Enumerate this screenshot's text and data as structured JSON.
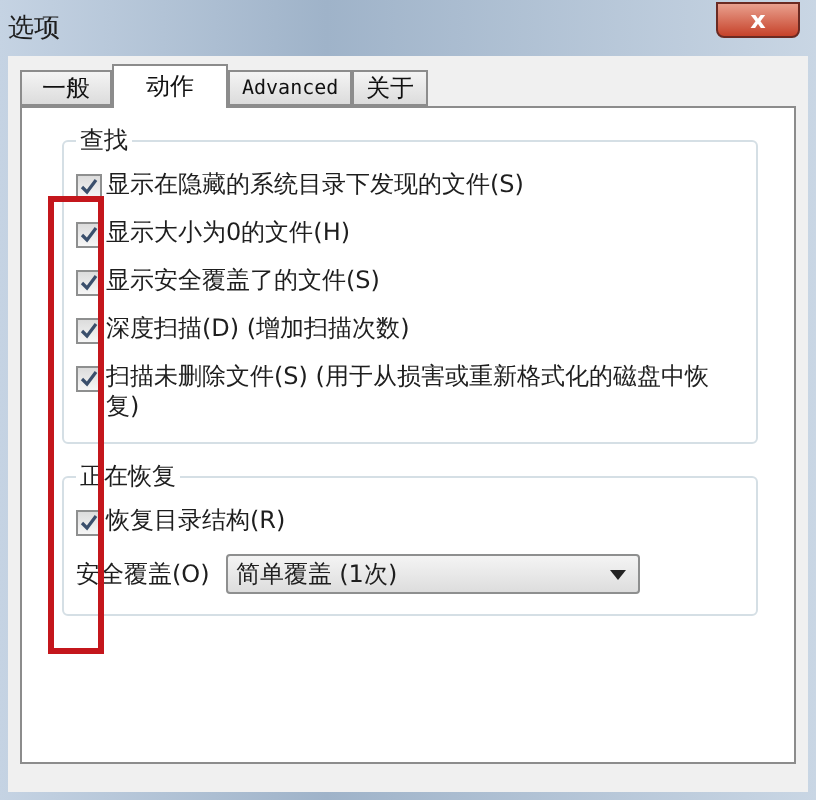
{
  "window": {
    "title": "选项",
    "close": "x"
  },
  "tabs": [
    {
      "label": "一般",
      "selected": false
    },
    {
      "label": "动作",
      "selected": true
    },
    {
      "label": "Advanced",
      "selected": false
    },
    {
      "label": "关于",
      "selected": false
    }
  ],
  "groups": [
    {
      "title": "查找",
      "options": [
        {
          "label": "显示在隐藏的系统目录下发现的文件(S)",
          "checked": true
        },
        {
          "label": "显示大小为0的文件(H)",
          "checked": true
        },
        {
          "label": "显示安全覆盖了的文件(S)",
          "checked": true
        },
        {
          "label": "深度扫描(D) (增加扫描次数)",
          "checked": true
        },
        {
          "label": "扫描未删除文件(S) (用于从损害或重新格式化的磁盘中恢复)",
          "checked": true
        }
      ]
    },
    {
      "title": "正在恢复",
      "options": [
        {
          "label": "恢复目录结构(R)",
          "checked": true
        }
      ],
      "select": {
        "label": "安全覆盖(O)",
        "value": "简单覆盖 (1次)"
      }
    }
  ]
}
